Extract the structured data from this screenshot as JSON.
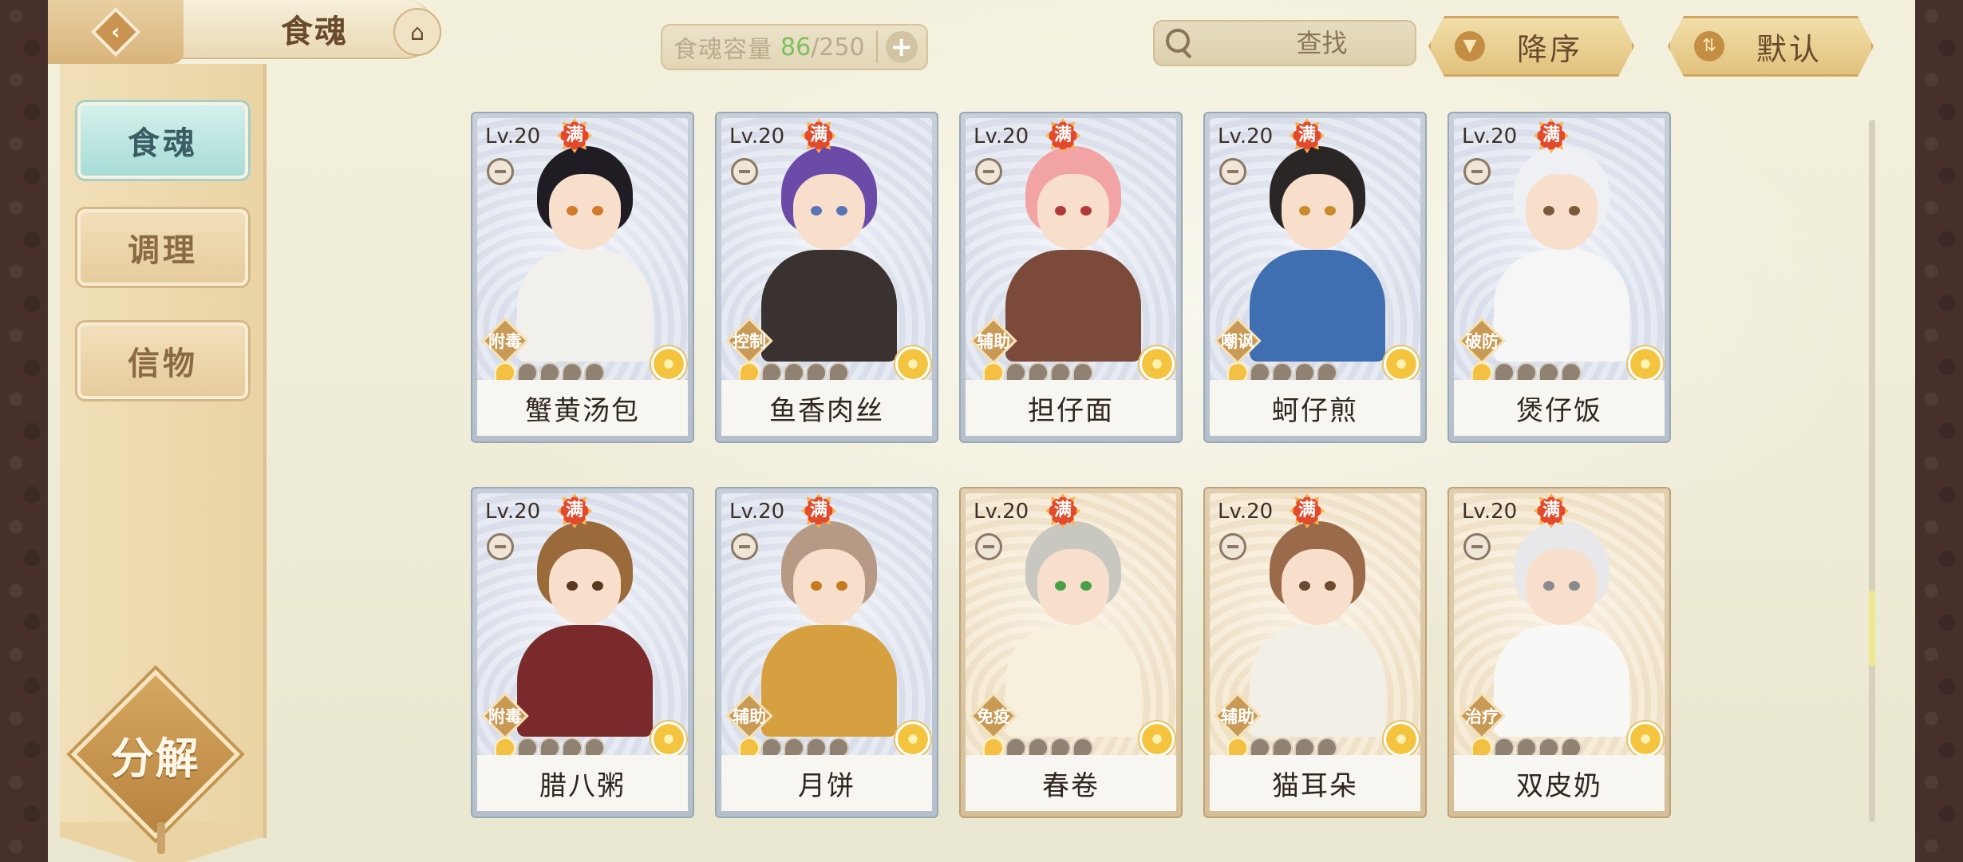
{
  "header": {
    "back_icon": "back-arrow-icon",
    "title": "食魂",
    "home_icon": "temple-icon",
    "capacity": {
      "label": "食魂容量",
      "current": "86",
      "max": "/250",
      "add_icon": "plus-icon"
    },
    "search": {
      "placeholder": "查找",
      "icon": "search-icon",
      "clear": "✕"
    },
    "sort_order": {
      "label": "降序",
      "icon": "triangle-down-icon"
    },
    "sort_mode": {
      "label": "默认",
      "icon": "swap-icon"
    }
  },
  "sidebar": {
    "items": [
      {
        "label": "食魂",
        "active": true
      },
      {
        "label": "调理",
        "active": false
      },
      {
        "label": "信物",
        "active": false
      }
    ],
    "decompose_label": "分解"
  },
  "cards": [
    {
      "level": "Lv.20",
      "max_badge": "满",
      "role": "附毒",
      "name": "蟹黄汤包",
      "stars": 1,
      "frame": "blue"
    },
    {
      "level": "Lv.20",
      "max_badge": "满",
      "role": "控制",
      "name": "鱼香肉丝",
      "stars": 1,
      "frame": "blue"
    },
    {
      "level": "Lv.20",
      "max_badge": "满",
      "role": "辅助",
      "name": "担仔面",
      "stars": 1,
      "frame": "blue"
    },
    {
      "level": "Lv.20",
      "max_badge": "满",
      "role": "嘲讽",
      "name": "蚵仔煎",
      "stars": 1,
      "frame": "blue"
    },
    {
      "level": "Lv.20",
      "max_badge": "满",
      "role": "破防",
      "name": "煲仔饭",
      "stars": 1,
      "frame": "blue"
    },
    {
      "level": "Lv.20",
      "max_badge": "满",
      "role": "附毒",
      "name": "腊八粥",
      "stars": 1,
      "frame": "blue"
    },
    {
      "level": "Lv.20",
      "max_badge": "满",
      "role": "辅助",
      "name": "月饼",
      "stars": 1,
      "frame": "blue"
    },
    {
      "level": "Lv.20",
      "max_badge": "满",
      "role": "免疫",
      "name": "春卷",
      "stars": 1,
      "frame": "gold"
    },
    {
      "level": "Lv.20",
      "max_badge": "满",
      "role": "辅助",
      "name": "猫耳朵",
      "stars": 1,
      "frame": "gold"
    },
    {
      "level": "Lv.20",
      "max_badge": "满",
      "role": "治疗",
      "name": "双皮奶",
      "stars": 1,
      "frame": "gold"
    }
  ],
  "colors": {
    "capacity_current": "#7cbf5c",
    "active_tab": "#a7dcd6",
    "button_gold": "#e2c27d"
  }
}
